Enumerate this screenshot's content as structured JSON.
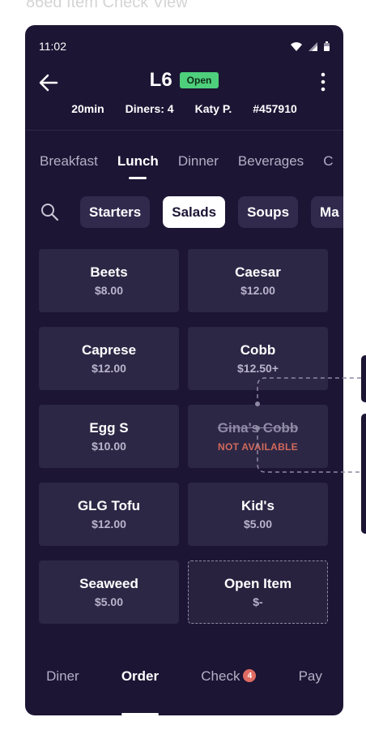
{
  "frame_label": "86ed Item Check View",
  "status_bar": {
    "time": "11:02",
    "icons": [
      "wifi-icon",
      "signal-icon",
      "battery-icon"
    ]
  },
  "header": {
    "table_id": "L6",
    "status_badge": "Open",
    "meta": {
      "duration": "20min",
      "diners": "Diners: 4",
      "server": "Katy P.",
      "check_number": "#457910"
    }
  },
  "menu_tabs": [
    {
      "label": "Breakfast",
      "active": false
    },
    {
      "label": "Lunch",
      "active": true
    },
    {
      "label": "Dinner",
      "active": false
    },
    {
      "label": "Beverages",
      "active": false
    },
    {
      "label": "C",
      "active": false
    }
  ],
  "category_chips": [
    {
      "label": "Starters",
      "active": false
    },
    {
      "label": "Salads",
      "active": true
    },
    {
      "label": "Soups",
      "active": false
    },
    {
      "label": "Ma",
      "active": false
    }
  ],
  "items": [
    {
      "name": "Beets",
      "price": "$8.00"
    },
    {
      "name": "Caesar",
      "price": "$12.00"
    },
    {
      "name": "Caprese",
      "price": "$12.00"
    },
    {
      "name": "Cobb",
      "price": "$12.50+"
    },
    {
      "name": "Egg S",
      "price": "$10.00"
    },
    {
      "name": "Gina's Cobb",
      "status": "NOT AVAILABLE"
    },
    {
      "name": "GLG Tofu",
      "price": "$12.00"
    },
    {
      "name": "Kid's",
      "price": "$5.00"
    },
    {
      "name": "Seaweed",
      "price": "$5.00"
    },
    {
      "name": "Open Item",
      "price": "$-"
    }
  ],
  "bottom_nav": [
    {
      "label": "Diner",
      "active": false
    },
    {
      "label": "Order",
      "active": true
    },
    {
      "label": "Check",
      "active": false,
      "badge": "4"
    },
    {
      "label": "Pay",
      "active": false
    }
  ],
  "colors": {
    "background": "#1c1534",
    "tile": "#2d2746",
    "open_badge": "#4ecf7c",
    "not_available": "#d06a5a",
    "count_badge": "#e06b62"
  }
}
